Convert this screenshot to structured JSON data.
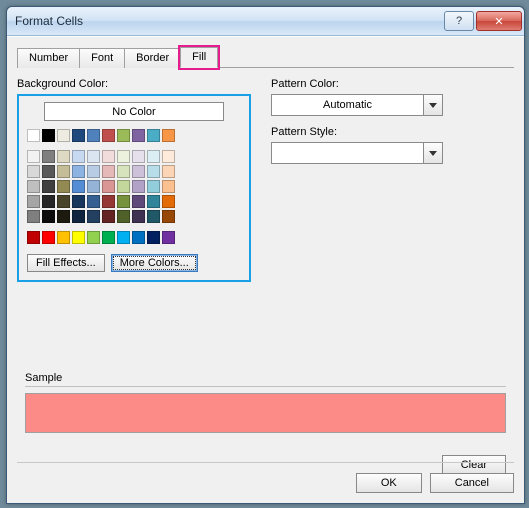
{
  "window": {
    "title": "Format Cells",
    "help_glyph": "?",
    "close_glyph": "✕"
  },
  "tabs": [
    "Number",
    "Font",
    "Border",
    "Fill"
  ],
  "active_tab_index": 3,
  "labels": {
    "background_color": "Background Color:",
    "pattern_color": "Pattern Color:",
    "pattern_style": "Pattern Style:",
    "sample": "Sample"
  },
  "background_color": {
    "no_color_label": "No Color",
    "fill_effects_btn": "Fill Effects...",
    "more_colors_btn": "More Colors...",
    "theme_row1": [
      "#ffffff",
      "#000000",
      "#eeece1",
      "#1f497d",
      "#4f81bd",
      "#c0504d",
      "#9bbb59",
      "#8064a2",
      "#4bacc6",
      "#f79646"
    ],
    "theme_tints": [
      [
        "#f2f2f2",
        "#7f7f7f",
        "#ddd9c3",
        "#c6d9f0",
        "#dbe5f1",
        "#f2dcdb",
        "#ebf1dd",
        "#e5e0ec",
        "#dbeef3",
        "#fdeada"
      ],
      [
        "#d8d8d8",
        "#595959",
        "#c4bd97",
        "#8db3e2",
        "#b8cce4",
        "#e5b9b7",
        "#d7e3bc",
        "#ccc1d9",
        "#b7dde8",
        "#fbd5b5"
      ],
      [
        "#bfbfbf",
        "#3f3f3f",
        "#938953",
        "#548dd4",
        "#95b3d7",
        "#d99694",
        "#c3d69b",
        "#b2a2c7",
        "#92cddc",
        "#fac08f"
      ],
      [
        "#a5a5a5",
        "#262626",
        "#494429",
        "#17365d",
        "#366092",
        "#953734",
        "#76923c",
        "#5f497a",
        "#31859b",
        "#e36c09"
      ],
      [
        "#7f7f7f",
        "#0c0c0c",
        "#1d1b10",
        "#0f243e",
        "#244061",
        "#632423",
        "#4f6128",
        "#3f3151",
        "#205867",
        "#974806"
      ]
    ],
    "standard_row": [
      "#c00000",
      "#ff0000",
      "#ffc000",
      "#ffff00",
      "#92d050",
      "#00b050",
      "#00b0f0",
      "#0070c0",
      "#002060",
      "#7030a0"
    ]
  },
  "pattern_color": {
    "value": "Automatic"
  },
  "pattern_style": {
    "value": ""
  },
  "sample": {
    "fill_hex": "#fc8a86"
  },
  "buttons": {
    "clear": "Clear",
    "ok": "OK",
    "cancel": "Cancel"
  }
}
